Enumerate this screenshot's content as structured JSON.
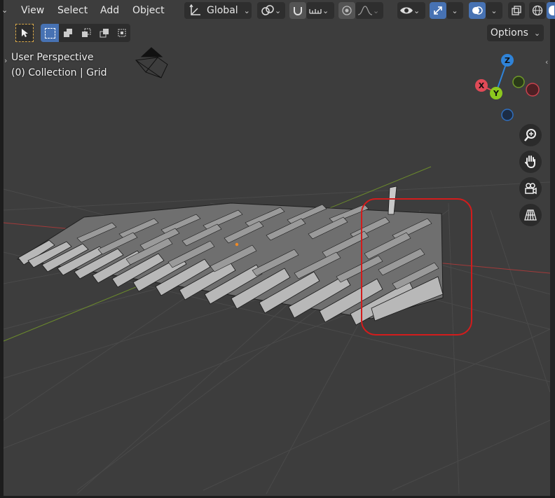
{
  "header": {
    "menu": [
      "View",
      "Select",
      "Add",
      "Object"
    ],
    "transform_orientation": "Global"
  },
  "toolbar": {
    "options_label": "Options"
  },
  "viewport": {
    "view_name": "User Perspective",
    "collection_info": "(0) Collection | Grid"
  },
  "gizmo": {
    "x_label": "X",
    "y_label": "Y",
    "z_label": "Z"
  },
  "colors": {
    "accent": "#4772b3",
    "axis_x": "#e04a57",
    "axis_y": "#8cc81e",
    "axis_z": "#2f83d8",
    "highlight_box": "#d31c1c"
  }
}
